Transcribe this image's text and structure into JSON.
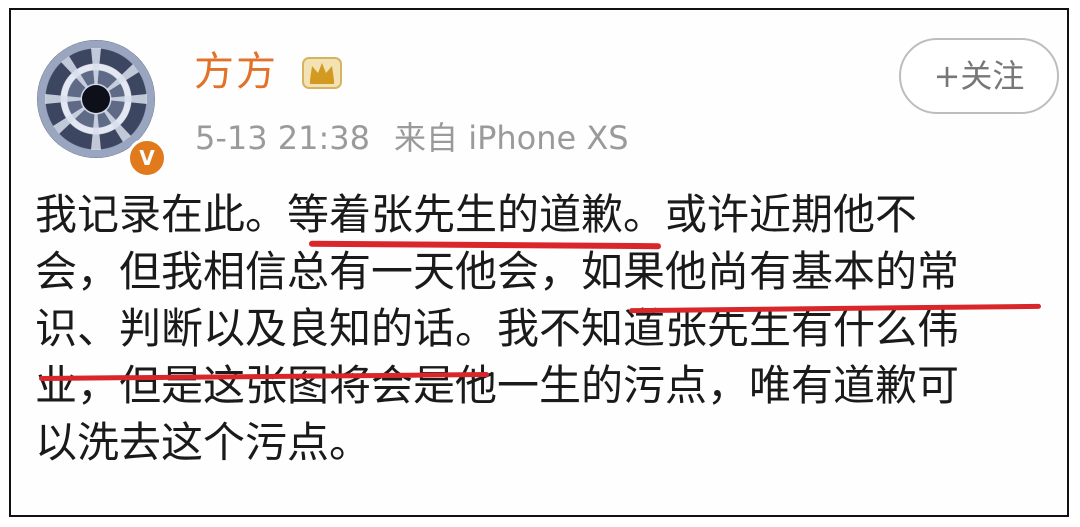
{
  "user": {
    "name": "方方",
    "verified_badge": "V",
    "crown_icon": "crown-icon"
  },
  "meta": {
    "time": "5-13 21:38",
    "source": "来自 iPhone XS"
  },
  "follow_button": {
    "label": "+关注"
  },
  "post": {
    "lines": [
      [
        "我记录在此。",
        "等着张先生的道歉",
        "。或许近期他不"
      ],
      [
        "会，但我相信总有一天他会，",
        "如果他尚有基本的常"
      ],
      [
        "识、判断以及良知的话",
        "。我不知道张先生有什么伟"
      ],
      [
        "业，但是这张图将会是他一生的污点，唯有道歉可"
      ],
      [
        "以洗去这个污点。"
      ]
    ]
  },
  "colors": {
    "name": "#e2722a",
    "meta": "#9a9a9a",
    "underline": "#d8262a",
    "badge": "#e07a1d"
  }
}
